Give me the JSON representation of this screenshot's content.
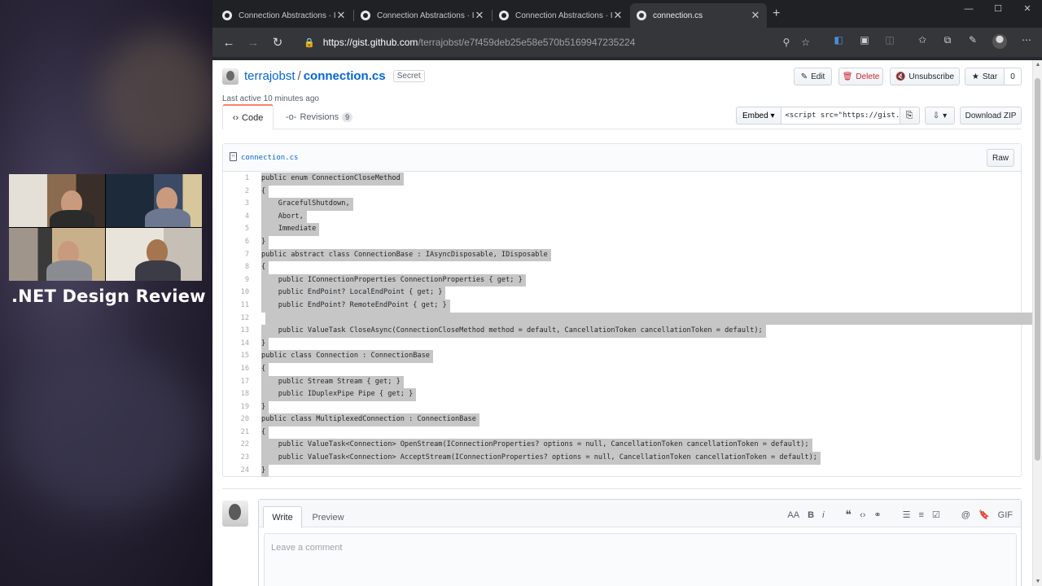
{
  "stream": {
    "title": ".NET Design Review"
  },
  "browser": {
    "tabs": [
      {
        "title": "Connection Abstractions · Issue",
        "active": false
      },
      {
        "title": "Connection Abstractions · Issue",
        "active": false
      },
      {
        "title": "Connection Abstractions · Issue",
        "active": false
      },
      {
        "title": "connection.cs",
        "active": true
      }
    ],
    "url_host": "https://gist.github.com",
    "url_path": "/terrajobst/e7f459deb25e58e570b5169947235224"
  },
  "gist": {
    "owner": "terrajobst",
    "separator": "/",
    "filename": "connection.cs",
    "badge": "Secret",
    "meta": "Last active 10 minutes ago",
    "actions": {
      "edit": "Edit",
      "delete": "Delete",
      "unsubscribe": "Unsubscribe",
      "star": "Star",
      "star_count": "0"
    },
    "tabs": {
      "code": "Code",
      "revisions": "Revisions",
      "revisions_count": "9"
    },
    "embed": {
      "label": "Embed",
      "value": "<script src=\"https://gist.",
      "download": "Download ZIP"
    }
  },
  "file": {
    "name": "connection.cs",
    "raw_label": "Raw",
    "lines": [
      {
        "n": "1",
        "text": "public enum ConnectionCloseMethod"
      },
      {
        "n": "2",
        "text": "{"
      },
      {
        "n": "3",
        "text": "    GracefulShutdown,"
      },
      {
        "n": "4",
        "text": "    Abort,"
      },
      {
        "n": "5",
        "text": "    Immediate"
      },
      {
        "n": "6",
        "text": "}"
      },
      {
        "n": "7",
        "text": "public abstract class ConnectionBase : IAsyncDisposable, IDisposable"
      },
      {
        "n": "8",
        "text": "{"
      },
      {
        "n": "9",
        "text": "    public IConnectionProperties ConnectionProperties { get; }"
      },
      {
        "n": "10",
        "text": "    public EndPoint? LocalEndPoint { get; }"
      },
      {
        "n": "11",
        "text": "    public EndPoint? RemoteEndPoint { get; }"
      },
      {
        "n": "12",
        "text": ""
      },
      {
        "n": "13",
        "text": "    public ValueTask CloseAsync(ConnectionCloseMethod method = default, CancellationToken cancellationToken = default);"
      },
      {
        "n": "14",
        "text": "}"
      },
      {
        "n": "15",
        "text": "public class Connection : ConnectionBase"
      },
      {
        "n": "16",
        "text": "{"
      },
      {
        "n": "17",
        "text": "    public Stream Stream { get; }"
      },
      {
        "n": "18",
        "text": "    public IDuplexPipe Pipe { get; }"
      },
      {
        "n": "19",
        "text": "}"
      },
      {
        "n": "20",
        "text": "public class MultiplexedConnection : ConnectionBase"
      },
      {
        "n": "21",
        "text": "{"
      },
      {
        "n": "22",
        "text": "    public ValueTask<Connection> OpenStream(IConnectionProperties? options = null, CancellationToken cancellationToken = default);"
      },
      {
        "n": "23",
        "text": "    public ValueTask<Connection> AcceptStream(IConnectionProperties? options = null, CancellationToken cancellationToken = default);"
      },
      {
        "n": "24",
        "text": "}"
      }
    ]
  },
  "comment": {
    "write_tab": "Write",
    "preview_tab": "Preview",
    "placeholder": "Leave a comment",
    "tool_gif": "GIF"
  }
}
